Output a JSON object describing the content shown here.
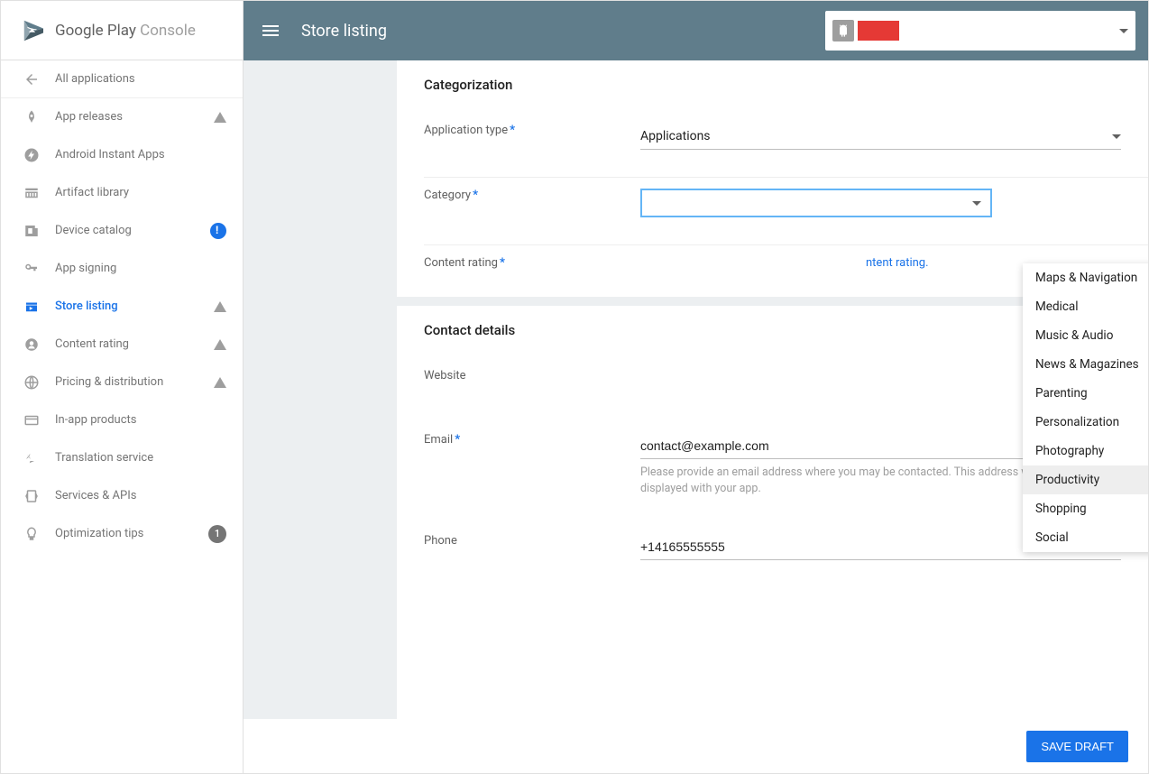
{
  "brand": {
    "name1": "Google Play",
    "name2": " Console"
  },
  "header": {
    "title": "Store listing"
  },
  "sidebar": {
    "all_apps": "All applications",
    "items": [
      {
        "label": "App releases",
        "badge": "warn"
      },
      {
        "label": "Android Instant Apps"
      },
      {
        "label": "Artifact library"
      },
      {
        "label": "Device catalog",
        "badge": "info"
      },
      {
        "label": "App signing"
      },
      {
        "label": "Store listing",
        "badge": "warn",
        "active": true
      },
      {
        "label": "Content rating",
        "badge": "warn"
      },
      {
        "label": "Pricing & distribution",
        "badge": "warn"
      },
      {
        "label": "In-app products"
      },
      {
        "label": "Translation service"
      },
      {
        "label": "Services & APIs"
      },
      {
        "label": "Optimization tips",
        "badge": "count",
        "count": "1"
      }
    ]
  },
  "cat_section": {
    "title": "Categorization",
    "app_type_label": "Application type",
    "app_type_value": "Applications",
    "category_label": "Category",
    "rating_label": "Content rating",
    "rating_link_suffix": "ntent rating."
  },
  "category_dropdown": {
    "options": [
      "Maps & Navigation",
      "Medical",
      "Music & Audio",
      "News & Magazines",
      "Parenting",
      "Personalization",
      "Photography",
      "Productivity",
      "Shopping",
      "Social"
    ],
    "highlighted": "Productivity"
  },
  "contact_section": {
    "title": "Contact details",
    "website_label": "Website",
    "email_label": "Email",
    "email_value": "contact@example.com",
    "email_help": "Please provide an email address where you may be contacted. This address will be publicly displayed with your app.",
    "phone_label": "Phone",
    "phone_value": "+14165555555"
  },
  "footer": {
    "save": "SAVE DRAFT"
  }
}
